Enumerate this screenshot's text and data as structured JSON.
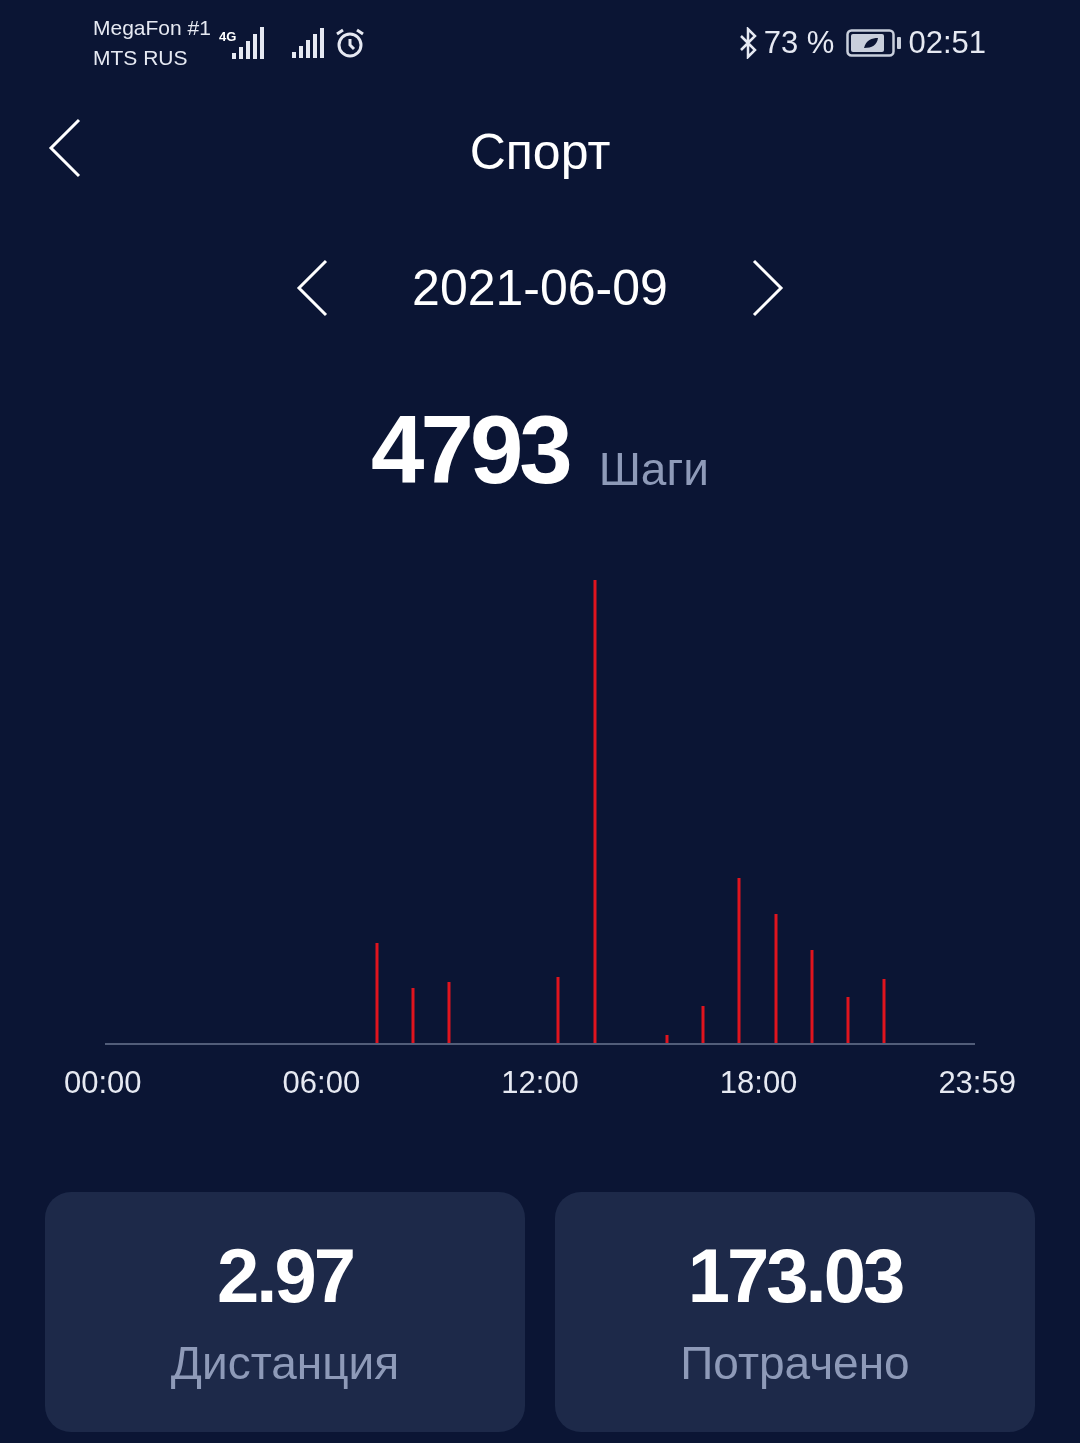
{
  "status_bar": {
    "carriers": [
      "MegaFon #1",
      "MTS RUS"
    ],
    "network": "4G",
    "battery": "73 %",
    "time": "02:51"
  },
  "header": {
    "title": "Спорт"
  },
  "date_nav": {
    "date": "2021-06-09"
  },
  "summary": {
    "steps": "4793",
    "unit": "Шаги"
  },
  "chart": {
    "axis_labels": [
      "00:00",
      "06:00",
      "12:00",
      "18:00",
      "23:59"
    ]
  },
  "cards": [
    {
      "value": "2.97",
      "label": "Дистанция"
    },
    {
      "value": "173.03",
      "label": "Потрачено"
    }
  ]
}
